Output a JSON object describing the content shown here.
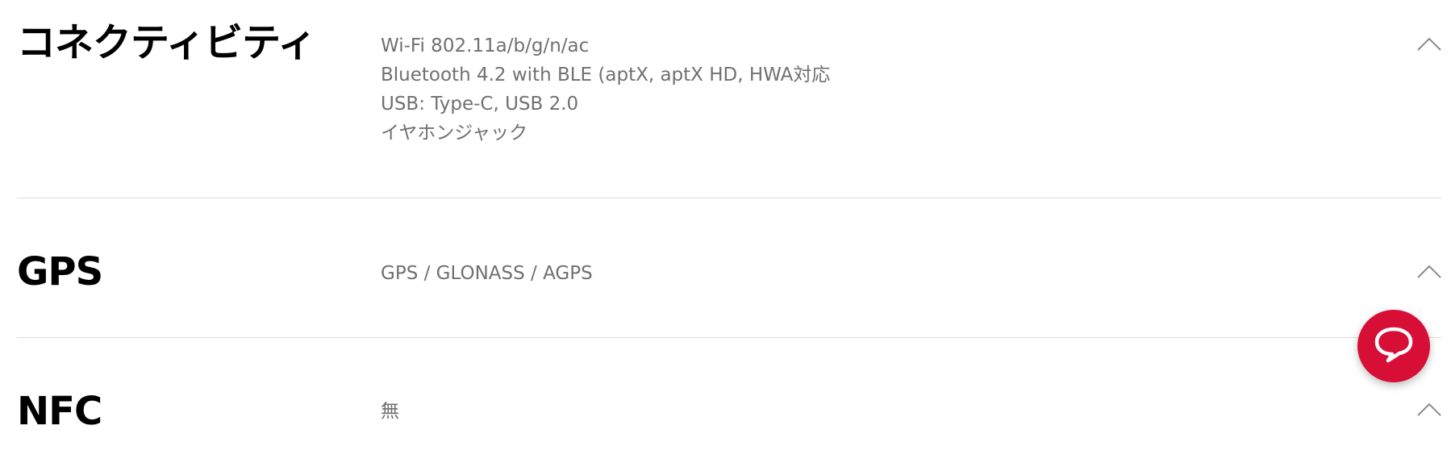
{
  "specs": [
    {
      "title": "コネクティビティ",
      "values": [
        "Wi-Fi 802.11a/b/g/n/ac",
        "Bluetooth 4.2 with BLE (aptX, aptX HD, HWA対応",
        "USB: Type-C, USB 2.0",
        "イヤホンジャック"
      ],
      "toggle_icon": "chevron-up-icon"
    },
    {
      "title": "GPS",
      "values": [
        "GPS / GLONASS / AGPS"
      ],
      "toggle_icon": "chevron-up-icon"
    },
    {
      "title": "NFC",
      "values": [
        "無"
      ],
      "toggle_icon": "chevron-up-icon"
    }
  ],
  "chat_button": {
    "icon": "chat-bubble-icon",
    "color": "#d70f37"
  },
  "colors": {
    "title_text": "#000000",
    "value_text": "#707070",
    "divider": "#dcdcdc",
    "chevron": "#8a8a8a"
  }
}
